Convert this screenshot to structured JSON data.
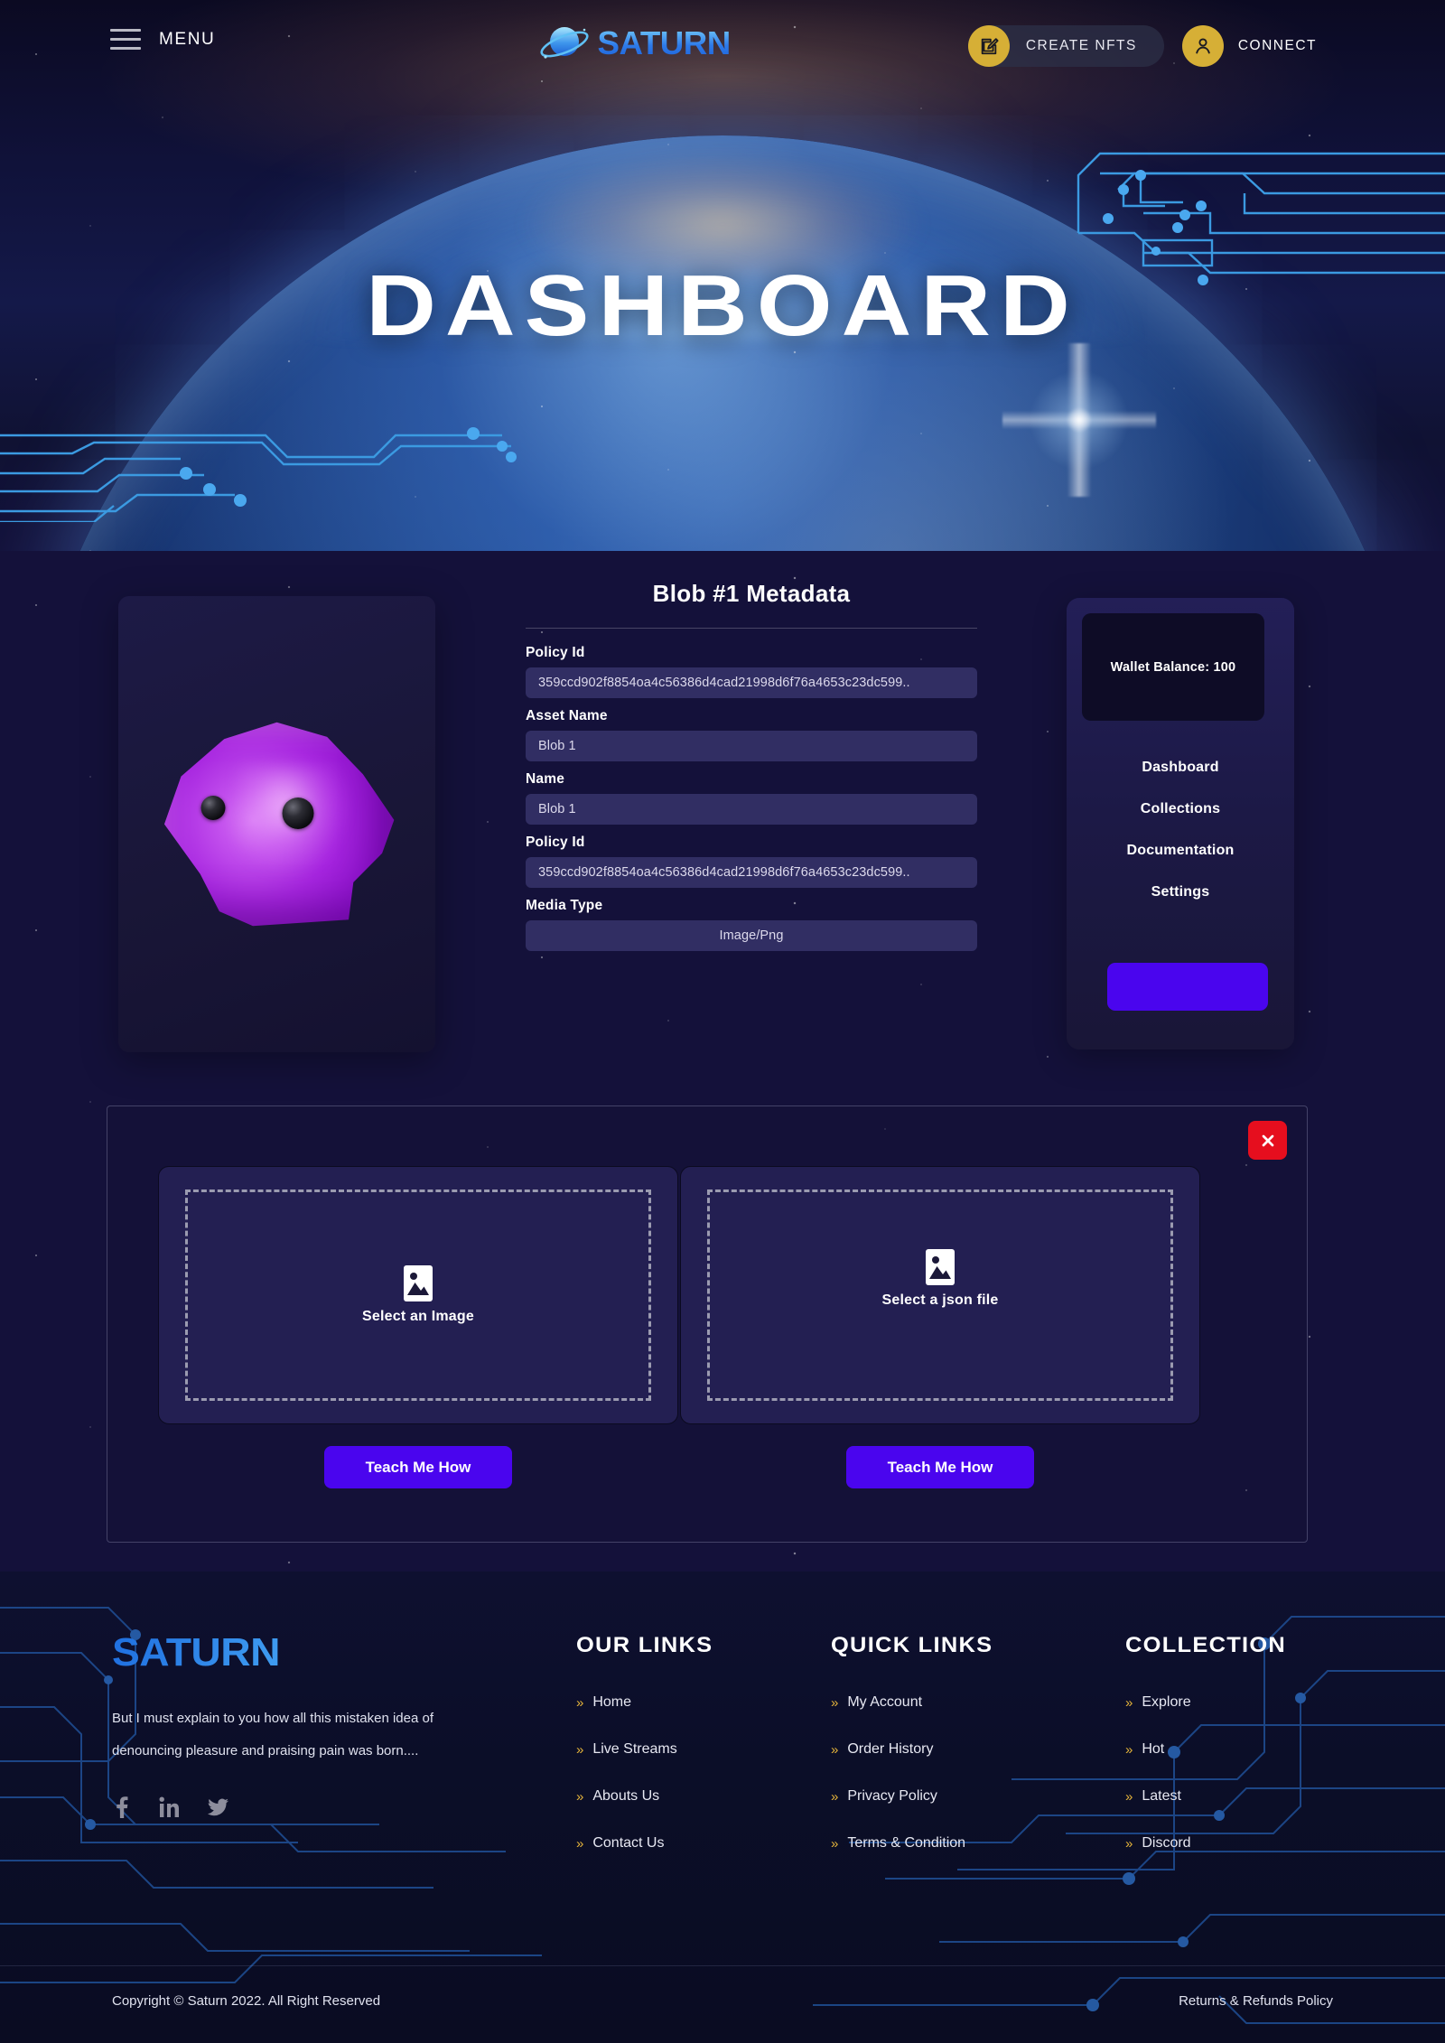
{
  "header": {
    "menu_label": "MENU",
    "logo_text": "SATURN",
    "create_nfts_label": "CREATE NFTS",
    "connect_label": "CONNECT"
  },
  "hero": {
    "title": "DASHBOARD"
  },
  "metadata": {
    "title": "Blob #1 Metadata",
    "fields": [
      {
        "label": "Policy Id",
        "value": "359ccd902f8854oa4c56386d4cad21998d6f76a4653c23dc599..",
        "align": "left"
      },
      {
        "label": "Asset Name",
        "value": "Blob 1",
        "align": "left"
      },
      {
        "label": "Name",
        "value": "Blob 1",
        "align": "left"
      },
      {
        "label": "Policy Id",
        "value": "359ccd902f8854oa4c56386d4cad21998d6f76a4653c23dc599..",
        "align": "left"
      },
      {
        "label": "Media Type",
        "value": "Image/Png",
        "align": "center"
      }
    ]
  },
  "sidebar": {
    "wallet_balance": "Wallet Balance: 100",
    "links": [
      {
        "label": "Dashboard"
      },
      {
        "label": "Collections"
      },
      {
        "label": "Documentation"
      },
      {
        "label": "Settings"
      }
    ],
    "cta_label": ""
  },
  "upload": {
    "image_drop_label": "Select an Image",
    "json_drop_label": "Select a json file",
    "teach_image_label": "Teach Me How",
    "teach_json_label": "Teach Me How"
  },
  "footer": {
    "logo_text": "SATURN",
    "description": "But I must explain to you how all this mistaken idea of denouncing pleasure and praising pain was born....",
    "socials": [
      {
        "name": "facebook"
      },
      {
        "name": "linkedin"
      },
      {
        "name": "twitter"
      }
    ],
    "columns": [
      {
        "heading": "OUR  LINKS",
        "links": [
          {
            "label": "Home"
          },
          {
            "label": "Live Streams"
          },
          {
            "label": "Abouts Us"
          },
          {
            "label": "Contact Us"
          }
        ]
      },
      {
        "heading": "QUICK LINKS",
        "links": [
          {
            "label": "My Account"
          },
          {
            "label": "Order History"
          },
          {
            "label": "Privacy Policy"
          },
          {
            "label": "Terms & Condition"
          }
        ]
      },
      {
        "heading": "COLLECTION",
        "links": [
          {
            "label": "Explore"
          },
          {
            "label": "Hot"
          },
          {
            "label": "Latest"
          },
          {
            "label": "Discord"
          }
        ]
      }
    ],
    "copyright": "Copyright © Saturn 2022. All Right Reserved",
    "policy_link": "Returns & Refunds Policy"
  },
  "colors": {
    "accent_purple": "#4a05ee",
    "accent_gold": "#d6af36",
    "accent_red": "#e60e1e",
    "circuit_blue": "#3b9ae1",
    "field_bg": "#312e63",
    "blob_purple": "#a726e0"
  }
}
